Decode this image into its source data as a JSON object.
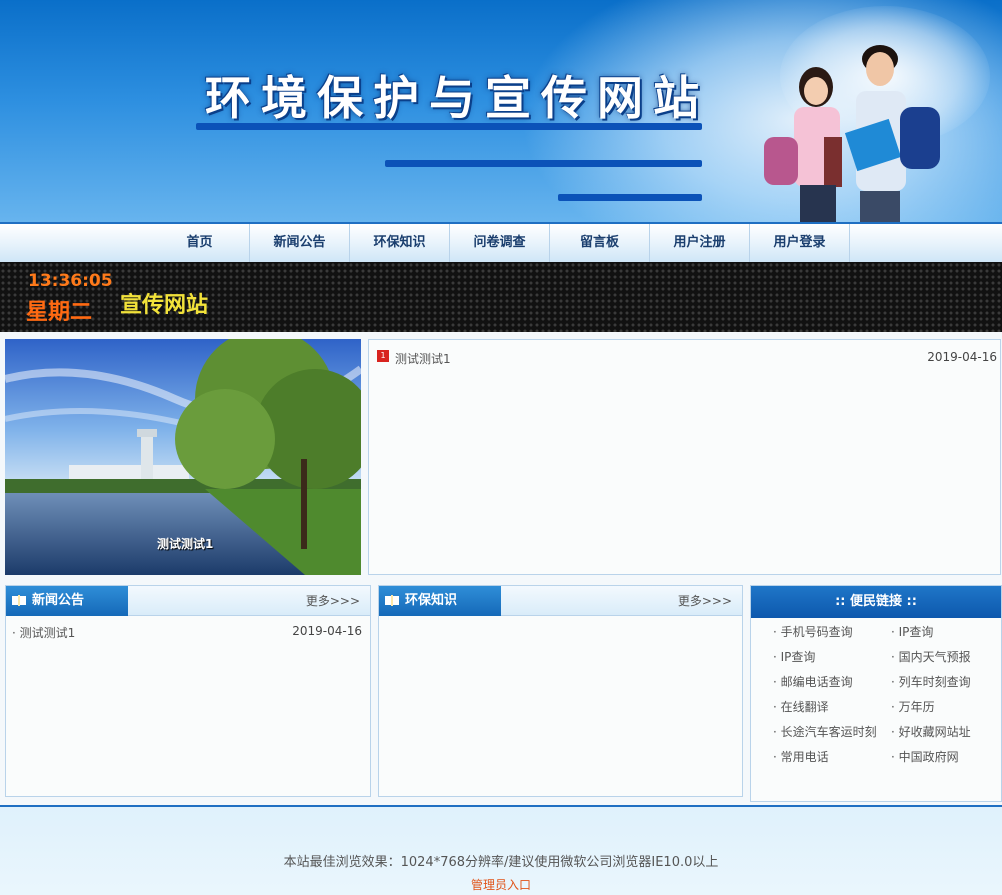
{
  "header": {
    "site_title": "环境保护与宣传网站"
  },
  "nav": {
    "items": [
      "首页",
      "新闻公告",
      "环保知识",
      "问卷调查",
      "留言板",
      "用户注册",
      "用户登录"
    ]
  },
  "ticker": {
    "time": "13:36:05",
    "weekday": "星期二",
    "scroll_text": "宣传网站"
  },
  "feature": {
    "caption": "测试测试1"
  },
  "latest": {
    "items": [
      {
        "title": "测试测试1",
        "date": "2019-04-16"
      }
    ]
  },
  "news_panel": {
    "title": "新闻公告",
    "more": "更多>>>",
    "items": [
      {
        "title": "测试测试1",
        "date": "2019-04-16"
      }
    ]
  },
  "knowledge_panel": {
    "title": "环保知识",
    "more": "更多>>>"
  },
  "links_panel": {
    "title": ":: 便民链接 ::",
    "links": [
      "手机号码查询",
      "IP查询",
      "IP查询",
      "国内天气预报",
      "邮编电话查询",
      "列车时刻查询",
      "在线翻译",
      "万年历",
      "长途汽车客运时刻",
      "好收藏网站址",
      "常用电话",
      "中国政府网"
    ]
  },
  "footer": {
    "info": "本站最佳浏览效果：1024*768分辨率/建议使用微软公司浏览器IE10.0以上",
    "admin_link": "管理员入口"
  }
}
